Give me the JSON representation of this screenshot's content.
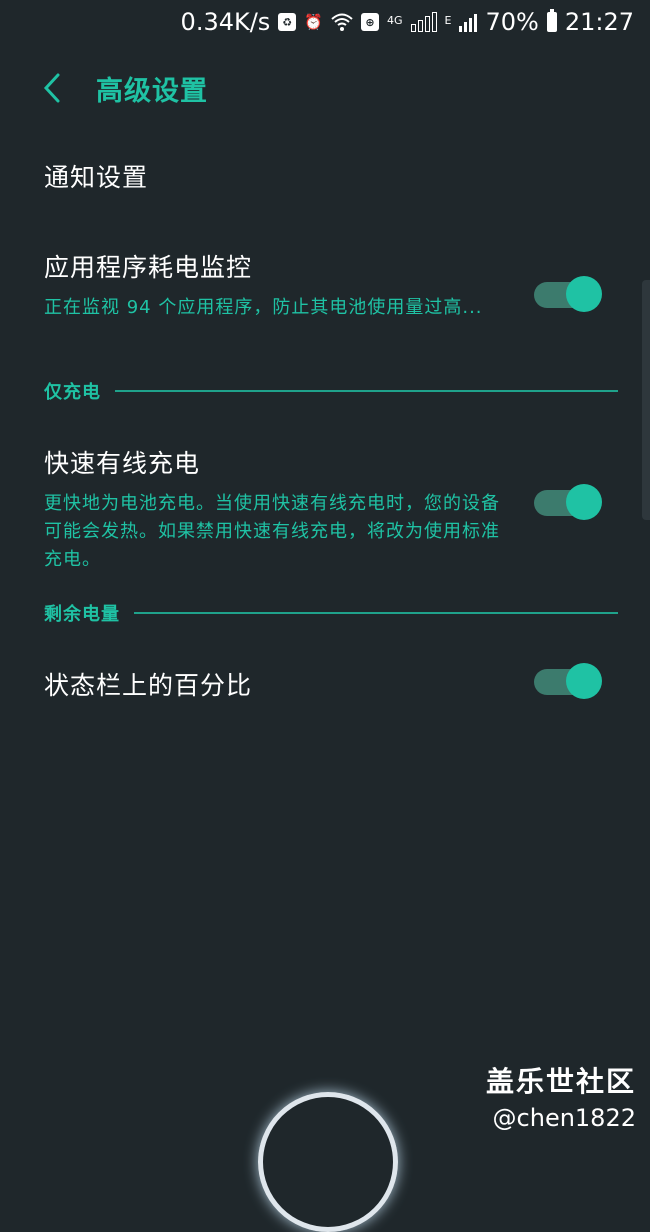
{
  "status_bar": {
    "speed": "0.34K/s",
    "network_4g": "4G",
    "network_e": "E",
    "battery_pct": "70%",
    "time": "21:27"
  },
  "header": {
    "title": "高级设置"
  },
  "items": {
    "notifications": {
      "title": "通知设置"
    },
    "app_power_monitor": {
      "title": "应用程序耗电监控",
      "subtitle": "正在监视 94 个应用程序，防止其电池使用量过高...",
      "enabled": true
    },
    "fast_wireless": {
      "title": "快速有线充电",
      "subtitle": "更快地为电池充电。当使用快速有线充电时，您的设备可能会发热。如果禁用快速有线充电，将改为使用标准充电。",
      "enabled": true
    },
    "status_percent": {
      "title": "状态栏上的百分比",
      "enabled": true
    }
  },
  "sections": {
    "charging_only": "仅充电",
    "remaining_battery": "剩余电量"
  },
  "watermark": {
    "line1": "盖乐世社区",
    "line2": "@chen1822"
  },
  "colors": {
    "accent": "#1fc2a4",
    "background": "#1f272b",
    "track": "#3c7b6d"
  }
}
